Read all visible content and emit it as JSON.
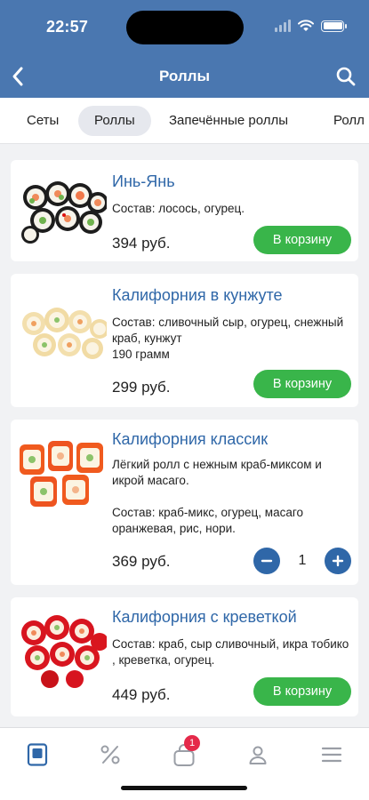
{
  "status_bar": {
    "time": "22:57"
  },
  "nav": {
    "title": "Роллы",
    "back_icon": "chevron-left-icon",
    "search_icon": "search-icon"
  },
  "tabs": [
    {
      "label": "Сеты",
      "active": false
    },
    {
      "label": "Роллы",
      "active": true
    },
    {
      "label": "Запечённые роллы",
      "active": false
    },
    {
      "label": "Ролл",
      "active": false
    }
  ],
  "products": [
    {
      "name": "Инь-Янь",
      "description": "Состав: лосось, огурец.",
      "price": "394 руб.",
      "action": "В корзину"
    },
    {
      "name": "Калифорния в кунжуте",
      "description": "Состав: сливочный сыр, огурец, снежный краб, кунжут\n190 грамм",
      "price": "299 руб.",
      "action": "В корзину"
    },
    {
      "name": "Калифорния классик",
      "description": "Лёгкий ролл с нежным краб-миксом и икрой масаго.\n\nСостав: краб-микс, огурец, масаго оранжевая, рис, нори.",
      "price": "369 руб.",
      "quantity": "1"
    },
    {
      "name": "Калифорния с креветкой",
      "description": "Состав: краб, сыр сливочный, икра тобико , креветка, огурец.",
      "price": "449 руб.",
      "action": "В корзину"
    }
  ],
  "tabbar": {
    "items": [
      "menu-book-icon",
      "discount-percent-icon",
      "cart-bag-icon",
      "profile-icon",
      "hamburger-menu-icon"
    ],
    "cart_badge": "1"
  },
  "colors": {
    "header": "#4a77b0",
    "link": "#2f67a8",
    "add_button": "#39b54a",
    "badge": "#e5294a"
  }
}
